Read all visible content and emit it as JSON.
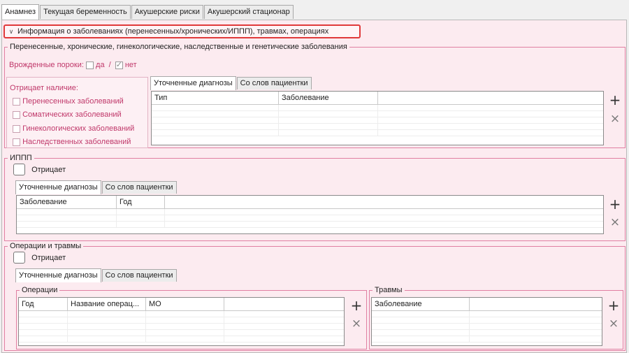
{
  "tabs": [
    "Анамнез",
    "Текущая беременность",
    "Акушерские риски",
    "Акушерский стационар"
  ],
  "accordion_title": "Информация о заболеваниях (перенесенных/хронических/ИППП), травмах, операциях",
  "section1": {
    "legend": "Перенесенные, хронические, гинекологические, наследственные и генетические заболевания",
    "congenital_label": "Врожденные пороки:",
    "yes": "да",
    "sep": "/",
    "no": "нет",
    "denies_label": "Отрицает наличие:",
    "denies_items": [
      "Перенесенных заболеваний",
      "Соматических заболеваний",
      "Гинекологических заболеваний",
      "Наследственных заболеваний"
    ],
    "subtabs": [
      "Уточненные диагнозы",
      "Со слов пациентки"
    ],
    "columns": [
      "Тип",
      "Заболевание"
    ]
  },
  "section2": {
    "legend": "ИППП",
    "denies": "Отрицает",
    "subtabs": [
      "Уточненные диагнозы",
      "Со слов пациентки"
    ],
    "columns": [
      "Заболевание",
      "Год"
    ]
  },
  "section3": {
    "legend": "Операции и травмы",
    "denies": "Отрицает",
    "subtabs": [
      "Уточненные диагнозы",
      "Со слов пациентки"
    ],
    "ops_legend": "Операции",
    "ops_columns": [
      "Год",
      "Название операц...",
      "МО"
    ],
    "trauma_legend": "Травмы",
    "trauma_columns": [
      "Заболевание"
    ]
  },
  "icons": {
    "add": "+",
    "remove": "×"
  },
  "colors": {
    "pink_bg": "#fcebf0",
    "pink_border": "#e07fa2",
    "accent_text": "#c0386a",
    "highlight": "#e03a3a"
  }
}
